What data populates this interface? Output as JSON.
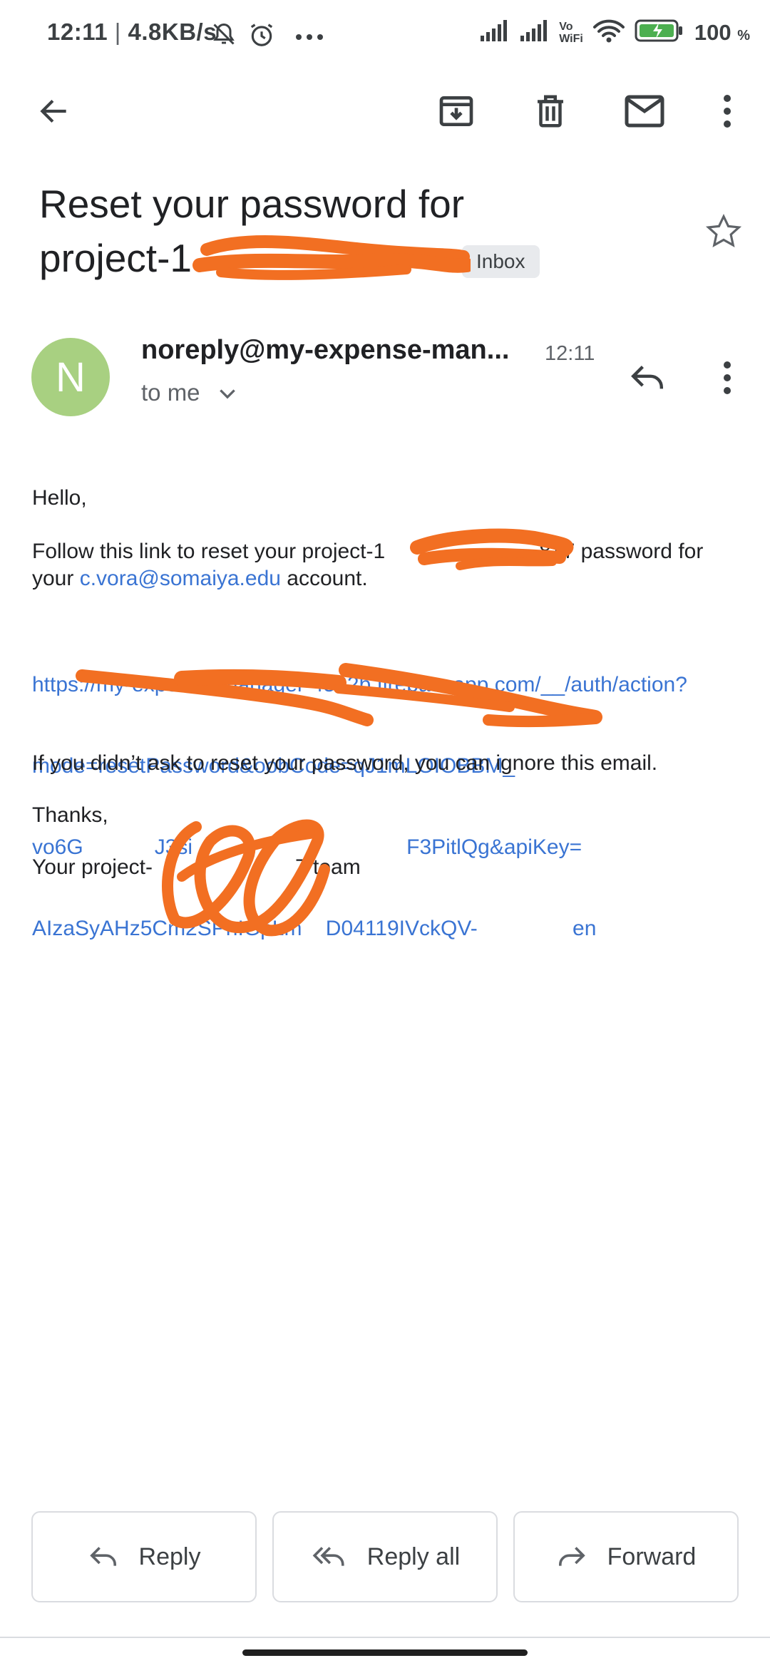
{
  "status_bar": {
    "time": "12:11",
    "speed": "4.8KB/s",
    "battery_percent": "100",
    "battery_unit": "%",
    "vowifi_top": "Vo",
    "vowifi_bottom": "WiFi"
  },
  "toolbar": {
    "icons": [
      "back-arrow-icon",
      "archive-icon",
      "delete-icon",
      "mark-unread-icon",
      "more-vert-icon"
    ]
  },
  "email": {
    "subject_line1": "Reset your password for",
    "subject_line2_prefix": "project-1",
    "inbox_label": "Inbox",
    "sender_initial": "N",
    "sender": "noreply@my-expense-man...",
    "time": "12:11",
    "to": "to me",
    "body": {
      "greeting": "Hello,",
      "para1_part1": "Follow this link to reset your project-1",
      "para1_part2": "837 password for",
      "para1_part3": "your ",
      "para1_email": "c.vora@somaiya.edu",
      "para1_part4": " account.",
      "link_line1": "https://my-expense-manager-4562b.firebaseapp.com/__/auth/action?",
      "link_line2": "mode=resetPassword&oobCode=qJ1mLOIOBBM_",
      "link_line3": "vo6G            J3si                                    F3PitlQg&apiKey=",
      "link_line4": "AIzaSyAHz5Cm2SPhIGpLm    D04119IVckQV-                en",
      "para2": "If you didn’t ask to reset your password, you can ignore this email.",
      "thanks": "Thanks,",
      "signature_prefix": "Your project-",
      "signature_suffix": "7 team"
    }
  },
  "actions": {
    "reply": "Reply",
    "reply_all": "Reply all",
    "forward": "Forward"
  },
  "colors": {
    "accent_link": "#3a74d3",
    "avatar": "#a8d081",
    "redaction": "#f26f22"
  }
}
